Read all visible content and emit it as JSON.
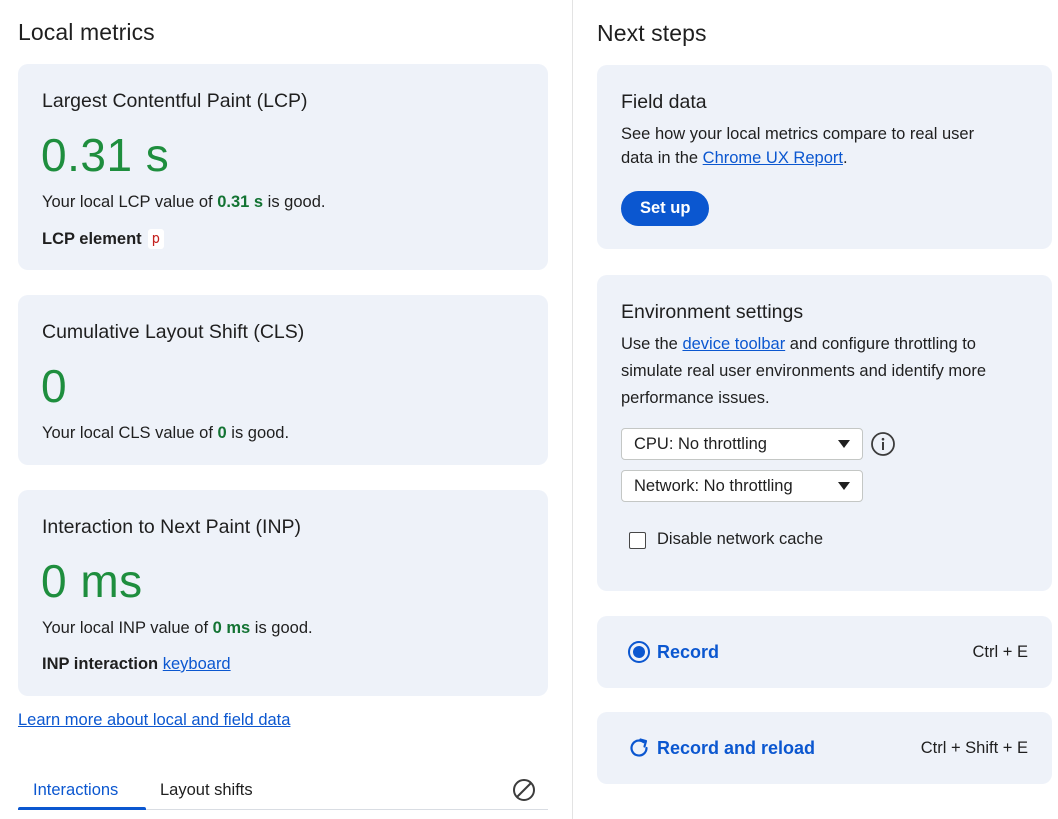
{
  "local_metrics": {
    "title": "Local metrics",
    "lcp": {
      "title": "Largest Contentful Paint (LCP)",
      "value": "0.31 s",
      "desc_prefix": "Your local LCP value of ",
      "desc_value": "0.31 s",
      "desc_suffix": " is good.",
      "element_label": "LCP element",
      "element_tag": "p"
    },
    "cls": {
      "title": "Cumulative Layout Shift (CLS)",
      "value": "0",
      "desc_prefix": "Your local CLS value of ",
      "desc_value": "0",
      "desc_suffix": " is good."
    },
    "inp": {
      "title": "Interaction to Next Paint (INP)",
      "value": "0 ms",
      "desc_prefix": "Your local INP value of ",
      "desc_value": "0 ms",
      "desc_suffix": " is good.",
      "interaction_label": "INP interaction",
      "interaction_link": "keyboard"
    },
    "learn_more_link": "Learn more about local and field data",
    "tabs": [
      {
        "label": "Interactions",
        "active": true
      },
      {
        "label": "Layout shifts",
        "active": false
      }
    ],
    "clear_icon": "clear-icon"
  },
  "next_steps": {
    "title": "Next steps",
    "field_data": {
      "title": "Field data",
      "text_line1": "See how your local metrics compare to real user",
      "text_line2_prefix": "data in the ",
      "text_line2_link": "Chrome UX Report",
      "text_line2_suffix": ".",
      "button": "Set up"
    },
    "environment": {
      "title": "Environment settings",
      "text_line1_prefix": "Use the ",
      "text_line1_link": "device toolbar",
      "text_line1_suffix": " and configure throttling to",
      "text_line2": "simulate real user environments and identify more",
      "text_line3": "performance issues.",
      "cpu_select": "CPU: No throttling",
      "network_select": "Network: No throttling",
      "info_icon": "info-icon",
      "disable_cache_label": "Disable network cache",
      "disable_cache_checked": false
    },
    "record": {
      "label": "Record",
      "shortcut": "Ctrl + E",
      "icon": "record-icon"
    },
    "record_reload": {
      "label": "Record and reload",
      "shortcut": "Ctrl + Shift + E",
      "icon": "reload-icon"
    }
  },
  "colors": {
    "good": "#1e8e3e",
    "accent": "#0b57d0",
    "card_bg": "#eef2f9",
    "element_tag": "#c5221f"
  }
}
